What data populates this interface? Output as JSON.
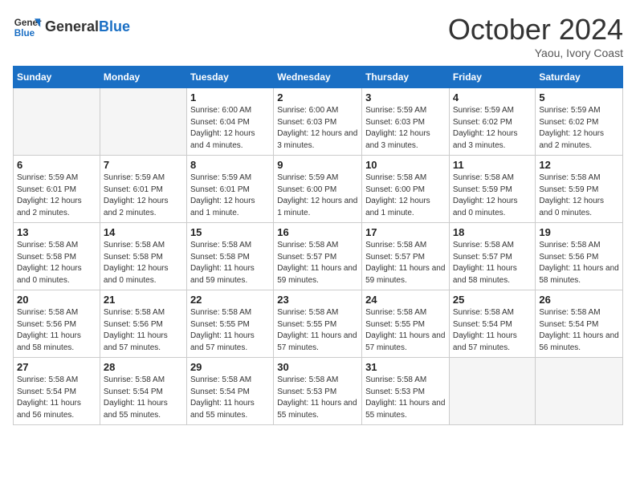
{
  "header": {
    "logo_line1": "General",
    "logo_line2": "Blue",
    "month_year": "October 2024",
    "location": "Yaou, Ivory Coast"
  },
  "weekdays": [
    "Sunday",
    "Monday",
    "Tuesday",
    "Wednesday",
    "Thursday",
    "Friday",
    "Saturday"
  ],
  "weeks": [
    [
      {
        "day": "",
        "info": ""
      },
      {
        "day": "",
        "info": ""
      },
      {
        "day": "1",
        "info": "Sunrise: 6:00 AM\nSunset: 6:04 PM\nDaylight: 12 hours and 4 minutes."
      },
      {
        "day": "2",
        "info": "Sunrise: 6:00 AM\nSunset: 6:03 PM\nDaylight: 12 hours and 3 minutes."
      },
      {
        "day": "3",
        "info": "Sunrise: 5:59 AM\nSunset: 6:03 PM\nDaylight: 12 hours and 3 minutes."
      },
      {
        "day": "4",
        "info": "Sunrise: 5:59 AM\nSunset: 6:02 PM\nDaylight: 12 hours and 3 minutes."
      },
      {
        "day": "5",
        "info": "Sunrise: 5:59 AM\nSunset: 6:02 PM\nDaylight: 12 hours and 2 minutes."
      }
    ],
    [
      {
        "day": "6",
        "info": "Sunrise: 5:59 AM\nSunset: 6:01 PM\nDaylight: 12 hours and 2 minutes."
      },
      {
        "day": "7",
        "info": "Sunrise: 5:59 AM\nSunset: 6:01 PM\nDaylight: 12 hours and 2 minutes."
      },
      {
        "day": "8",
        "info": "Sunrise: 5:59 AM\nSunset: 6:01 PM\nDaylight: 12 hours and 1 minute."
      },
      {
        "day": "9",
        "info": "Sunrise: 5:59 AM\nSunset: 6:00 PM\nDaylight: 12 hours and 1 minute."
      },
      {
        "day": "10",
        "info": "Sunrise: 5:58 AM\nSunset: 6:00 PM\nDaylight: 12 hours and 1 minute."
      },
      {
        "day": "11",
        "info": "Sunrise: 5:58 AM\nSunset: 5:59 PM\nDaylight: 12 hours and 0 minutes."
      },
      {
        "day": "12",
        "info": "Sunrise: 5:58 AM\nSunset: 5:59 PM\nDaylight: 12 hours and 0 minutes."
      }
    ],
    [
      {
        "day": "13",
        "info": "Sunrise: 5:58 AM\nSunset: 5:58 PM\nDaylight: 12 hours and 0 minutes."
      },
      {
        "day": "14",
        "info": "Sunrise: 5:58 AM\nSunset: 5:58 PM\nDaylight: 12 hours and 0 minutes."
      },
      {
        "day": "15",
        "info": "Sunrise: 5:58 AM\nSunset: 5:58 PM\nDaylight: 11 hours and 59 minutes."
      },
      {
        "day": "16",
        "info": "Sunrise: 5:58 AM\nSunset: 5:57 PM\nDaylight: 11 hours and 59 minutes."
      },
      {
        "day": "17",
        "info": "Sunrise: 5:58 AM\nSunset: 5:57 PM\nDaylight: 11 hours and 59 minutes."
      },
      {
        "day": "18",
        "info": "Sunrise: 5:58 AM\nSunset: 5:57 PM\nDaylight: 11 hours and 58 minutes."
      },
      {
        "day": "19",
        "info": "Sunrise: 5:58 AM\nSunset: 5:56 PM\nDaylight: 11 hours and 58 minutes."
      }
    ],
    [
      {
        "day": "20",
        "info": "Sunrise: 5:58 AM\nSunset: 5:56 PM\nDaylight: 11 hours and 58 minutes."
      },
      {
        "day": "21",
        "info": "Sunrise: 5:58 AM\nSunset: 5:56 PM\nDaylight: 11 hours and 57 minutes."
      },
      {
        "day": "22",
        "info": "Sunrise: 5:58 AM\nSunset: 5:55 PM\nDaylight: 11 hours and 57 minutes."
      },
      {
        "day": "23",
        "info": "Sunrise: 5:58 AM\nSunset: 5:55 PM\nDaylight: 11 hours and 57 minutes."
      },
      {
        "day": "24",
        "info": "Sunrise: 5:58 AM\nSunset: 5:55 PM\nDaylight: 11 hours and 57 minutes."
      },
      {
        "day": "25",
        "info": "Sunrise: 5:58 AM\nSunset: 5:54 PM\nDaylight: 11 hours and 57 minutes."
      },
      {
        "day": "26",
        "info": "Sunrise: 5:58 AM\nSunset: 5:54 PM\nDaylight: 11 hours and 56 minutes."
      }
    ],
    [
      {
        "day": "27",
        "info": "Sunrise: 5:58 AM\nSunset: 5:54 PM\nDaylight: 11 hours and 56 minutes."
      },
      {
        "day": "28",
        "info": "Sunrise: 5:58 AM\nSunset: 5:54 PM\nDaylight: 11 hours and 55 minutes."
      },
      {
        "day": "29",
        "info": "Sunrise: 5:58 AM\nSunset: 5:54 PM\nDaylight: 11 hours and 55 minutes."
      },
      {
        "day": "30",
        "info": "Sunrise: 5:58 AM\nSunset: 5:53 PM\nDaylight: 11 hours and 55 minutes."
      },
      {
        "day": "31",
        "info": "Sunrise: 5:58 AM\nSunset: 5:53 PM\nDaylight: 11 hours and 55 minutes."
      },
      {
        "day": "",
        "info": ""
      },
      {
        "day": "",
        "info": ""
      }
    ]
  ]
}
